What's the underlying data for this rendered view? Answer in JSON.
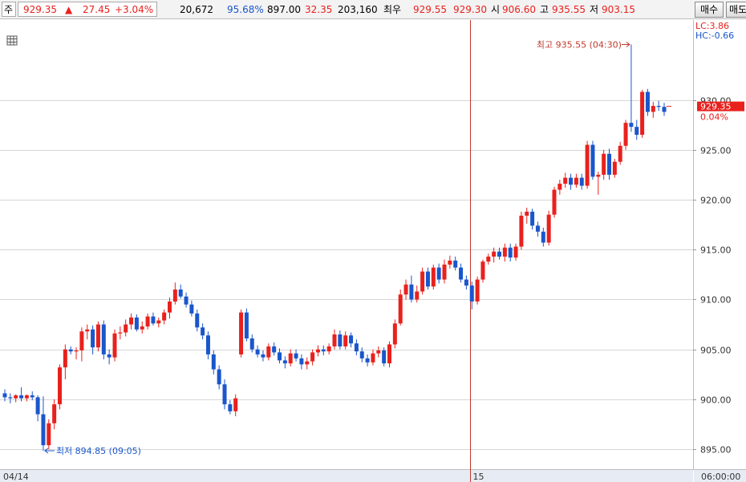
{
  "toolbar": {
    "code_label": "주",
    "price": "929.35",
    "change_arrow": "▲",
    "change": "27.45",
    "change_pct": "+3.04%",
    "volume": "20,672",
    "volume_ratio": "95.68%",
    "val_a": "897.00",
    "val_b": "32.35",
    "val_c": "203,160",
    "best_label": "최우",
    "best_ask": "929.55",
    "best_bid": "929.30",
    "open_label": "시",
    "open": "906.60",
    "high_label": "고",
    "high": "935.55",
    "low_label": "저",
    "low": "903.15",
    "buy_button": "매수",
    "sell_button": "매도"
  },
  "colors": {
    "up": "#e8211d",
    "down": "#1a56cc",
    "grid": "#d6d6d6",
    "divider": "#c0392b"
  },
  "icons": {
    "grid_toggle": "grid-icon"
  },
  "chart_data": {
    "type": "candlestick",
    "ylim": [
      893,
      938
    ],
    "y_ticks": [
      "930.00",
      "925.00",
      "920.00",
      "915.00",
      "910.00",
      "905.00",
      "900.00",
      "895.00"
    ],
    "x_labels": [
      "04/14",
      "15"
    ],
    "time_axis_label": "06:00:00",
    "info_labels": {
      "lc": "LC:3.86",
      "hc": "HC:-0.66"
    },
    "current": {
      "price": "929.35",
      "pct": "0.04%"
    },
    "high_annotation": "최고 935.55 (04:30)",
    "low_annotation": "최저 894.85 (09:05)",
    "day_divider_index": 85,
    "candles": [
      [
        900.6,
        901.0,
        899.8,
        900.2
      ],
      [
        900.2,
        900.6,
        899.6,
        900.1
      ],
      [
        900.1,
        900.5,
        899.7,
        900.4
      ],
      [
        900.4,
        901.2,
        899.8,
        900.1
      ],
      [
        900.1,
        900.5,
        899.8,
        900.4
      ],
      [
        900.4,
        900.8,
        899.9,
        900.2
      ],
      [
        900.2,
        900.4,
        897.8,
        898.5
      ],
      [
        898.5,
        900.3,
        894.85,
        895.4
      ],
      [
        895.4,
        898.0,
        895.0,
        897.6
      ],
      [
        897.6,
        900.0,
        897.0,
        899.5
      ],
      [
        899.5,
        903.5,
        899.0,
        903.2
      ],
      [
        903.2,
        905.5,
        902.0,
        905.0
      ],
      [
        905.0,
        905.3,
        904.5,
        904.8
      ],
      [
        904.8,
        905.2,
        904.0,
        904.9
      ],
      [
        904.9,
        907.2,
        903.8,
        906.8
      ],
      [
        906.8,
        907.5,
        906.0,
        907.0
      ],
      [
        907.0,
        907.4,
        904.5,
        905.2
      ],
      [
        905.2,
        907.8,
        904.8,
        907.5
      ],
      [
        907.5,
        907.9,
        904.0,
        904.5
      ],
      [
        904.5,
        905.0,
        903.5,
        904.2
      ],
      [
        904.2,
        907.0,
        903.8,
        906.6
      ],
      [
        906.6,
        907.3,
        906.0,
        906.7
      ],
      [
        906.7,
        908.0,
        906.3,
        907.5
      ],
      [
        907.5,
        908.6,
        907.0,
        908.2
      ],
      [
        908.2,
        908.5,
        906.8,
        907.0
      ],
      [
        907.0,
        907.8,
        906.6,
        907.3
      ],
      [
        907.3,
        908.6,
        907.0,
        908.3
      ],
      [
        908.3,
        908.7,
        907.4,
        907.6
      ],
      [
        907.6,
        908.2,
        907.2,
        907.9
      ],
      [
        907.9,
        909.0,
        907.5,
        908.7
      ],
      [
        908.7,
        910.2,
        908.1,
        909.8
      ],
      [
        909.8,
        911.7,
        909.5,
        911.0
      ],
      [
        911.0,
        911.5,
        910.1,
        910.3
      ],
      [
        910.3,
        910.7,
        909.2,
        909.5
      ],
      [
        909.5,
        909.9,
        908.3,
        908.6
      ],
      [
        908.6,
        909.0,
        906.8,
        907.2
      ],
      [
        907.2,
        907.6,
        906.0,
        906.4
      ],
      [
        906.4,
        906.8,
        904.0,
        904.5
      ],
      [
        904.5,
        904.9,
        902.5,
        903.0
      ],
      [
        903.0,
        903.4,
        901.0,
        901.5
      ],
      [
        901.5,
        902.0,
        899.0,
        899.5
      ],
      [
        899.5,
        899.9,
        898.5,
        898.8
      ],
      [
        898.8,
        900.5,
        898.3,
        900.1
      ],
      [
        904.5,
        909.0,
        904.2,
        908.7
      ],
      [
        908.7,
        909.1,
        905.8,
        906.1
      ],
      [
        906.1,
        906.5,
        904.7,
        905.0
      ],
      [
        905.0,
        905.4,
        904.2,
        904.5
      ],
      [
        904.5,
        904.9,
        903.8,
        904.2
      ],
      [
        904.2,
        905.6,
        903.9,
        905.3
      ],
      [
        905.3,
        905.7,
        904.4,
        904.7
      ],
      [
        904.7,
        905.1,
        903.6,
        903.9
      ],
      [
        903.9,
        904.3,
        903.1,
        903.6
      ],
      [
        903.6,
        905.0,
        903.3,
        904.6
      ],
      [
        904.6,
        905.0,
        903.8,
        904.1
      ],
      [
        904.1,
        904.5,
        903.0,
        903.5
      ],
      [
        903.5,
        904.2,
        903.0,
        903.8
      ],
      [
        903.8,
        905.0,
        903.4,
        904.7
      ],
      [
        904.7,
        905.4,
        904.3,
        905.0
      ],
      [
        905.0,
        905.4,
        904.4,
        904.8
      ],
      [
        904.8,
        905.6,
        904.5,
        905.3
      ],
      [
        905.3,
        907.0,
        905.0,
        906.5
      ],
      [
        906.5,
        906.9,
        905.0,
        905.3
      ],
      [
        905.3,
        906.8,
        905.0,
        906.4
      ],
      [
        906.4,
        906.7,
        905.2,
        905.6
      ],
      [
        905.6,
        906.0,
        904.4,
        904.8
      ],
      [
        904.8,
        905.2,
        903.7,
        904.1
      ],
      [
        904.1,
        904.5,
        903.3,
        903.7
      ],
      [
        903.7,
        905.0,
        903.4,
        904.6
      ],
      [
        904.6,
        905.3,
        904.2,
        904.9
      ],
      [
        904.9,
        905.2,
        903.3,
        903.6
      ],
      [
        903.6,
        905.8,
        903.2,
        905.5
      ],
      [
        905.5,
        908.0,
        905.1,
        907.6
      ],
      [
        907.6,
        911.0,
        907.4,
        910.5
      ],
      [
        910.5,
        912.0,
        910.0,
        911.5
      ],
      [
        911.5,
        912.4,
        909.7,
        910.0
      ],
      [
        910.0,
        911.4,
        909.7,
        910.8
      ],
      [
        910.8,
        913.2,
        910.5,
        912.8
      ],
      [
        912.8,
        913.2,
        911.0,
        911.3
      ],
      [
        911.3,
        913.5,
        911.0,
        913.2
      ],
      [
        913.2,
        913.6,
        911.6,
        912.0
      ],
      [
        912.0,
        914.0,
        911.6,
        913.5
      ],
      [
        913.5,
        914.4,
        913.1,
        913.9
      ],
      [
        913.9,
        914.3,
        912.9,
        913.2
      ],
      [
        913.2,
        913.6,
        911.7,
        912.0
      ],
      [
        912.0,
        912.4,
        911.0,
        911.4
      ],
      [
        911.4,
        911.8,
        909.0,
        909.8
      ],
      [
        909.8,
        912.3,
        909.5,
        912.0
      ],
      [
        912.0,
        914.0,
        911.7,
        913.8
      ],
      [
        913.8,
        914.6,
        913.5,
        914.3
      ],
      [
        914.3,
        915.2,
        913.7,
        914.8
      ],
      [
        914.8,
        915.2,
        914.0,
        914.3
      ],
      [
        914.3,
        915.6,
        913.8,
        915.2
      ],
      [
        915.2,
        915.6,
        913.8,
        914.2
      ],
      [
        914.2,
        915.6,
        913.9,
        915.3
      ],
      [
        915.3,
        918.8,
        915.0,
        918.4
      ],
      [
        918.4,
        919.2,
        917.6,
        918.8
      ],
      [
        918.8,
        919.1,
        917.0,
        917.4
      ],
      [
        917.4,
        917.8,
        916.3,
        916.8
      ],
      [
        916.8,
        917.2,
        915.3,
        915.7
      ],
      [
        915.7,
        918.9,
        915.4,
        918.5
      ],
      [
        918.5,
        921.3,
        918.2,
        921.0
      ],
      [
        921.0,
        922.0,
        920.5,
        921.6
      ],
      [
        921.6,
        922.7,
        921.2,
        922.2
      ],
      [
        922.2,
        922.6,
        921.0,
        921.5
      ],
      [
        921.5,
        922.6,
        921.2,
        922.2
      ],
      [
        922.2,
        922.6,
        921.0,
        921.4
      ],
      [
        921.4,
        925.9,
        921.1,
        925.5
      ],
      [
        925.5,
        925.9,
        922.0,
        922.3
      ],
      [
        922.3,
        922.8,
        920.5,
        922.5
      ],
      [
        922.5,
        925.0,
        922.0,
        924.6
      ],
      [
        924.6,
        925.1,
        922.0,
        922.5
      ],
      [
        922.5,
        924.1,
        922.2,
        923.8
      ],
      [
        923.8,
        925.8,
        923.5,
        925.4
      ],
      [
        925.4,
        928.0,
        925.0,
        927.7
      ],
      [
        927.7,
        935.55,
        926.8,
        927.3
      ],
      [
        927.3,
        928.0,
        926.0,
        926.5
      ],
      [
        926.5,
        931.0,
        926.2,
        930.8
      ],
      [
        930.8,
        931.1,
        928.4,
        928.8
      ],
      [
        928.8,
        929.8,
        928.2,
        929.4
      ],
      [
        929.4,
        929.9,
        928.9,
        929.3
      ],
      [
        929.3,
        929.7,
        928.4,
        928.8
      ]
    ]
  }
}
